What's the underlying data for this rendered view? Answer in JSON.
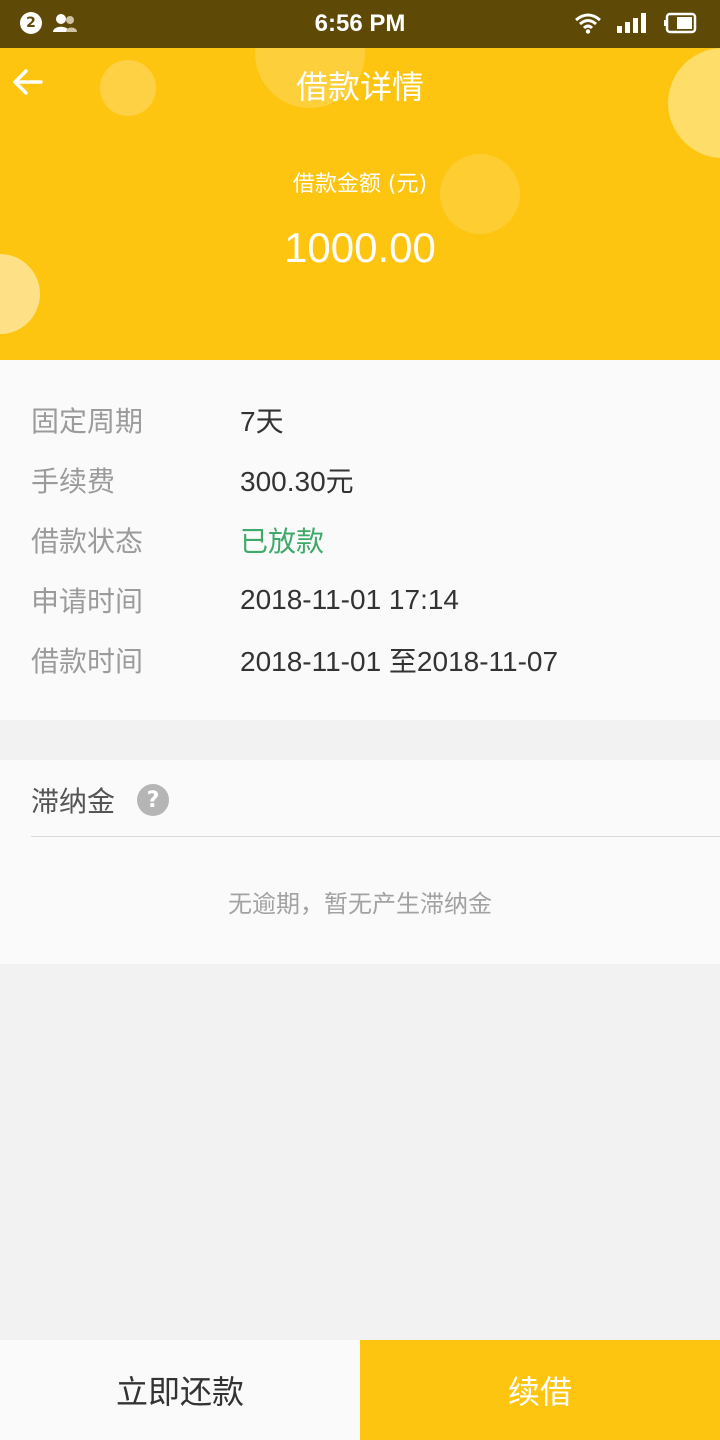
{
  "status_bar": {
    "notification_count": "2",
    "time": "6:56 PM",
    "icons": [
      "people-icon",
      "wifi-icon",
      "signal-icon",
      "battery-icon"
    ]
  },
  "header": {
    "title": "借款详情",
    "amount_label": "借款金额 (元)",
    "amount": "1000.00",
    "back_icon": "arrow-left-icon"
  },
  "details": [
    {
      "label": "固定周期",
      "value": "7天"
    },
    {
      "label": "手续费",
      "value": "300.30元"
    },
    {
      "label": "借款状态",
      "value": "已放款"
    },
    {
      "label": "申请时间",
      "value": "2018-11-01 17:14"
    },
    {
      "label": "借款时间",
      "value": "2018-11-01 至2018-11-07"
    }
  ],
  "late_fee": {
    "title": "滞纳金",
    "help_icon": "?",
    "empty_text": "无逾期，暂无产生滞纳金"
  },
  "actions": {
    "repay": "立即还款",
    "renew": "续借"
  },
  "colors": {
    "accent": "#fdc50f",
    "status_bar": "#5e4a06",
    "status_ok": "#3fa96a"
  }
}
